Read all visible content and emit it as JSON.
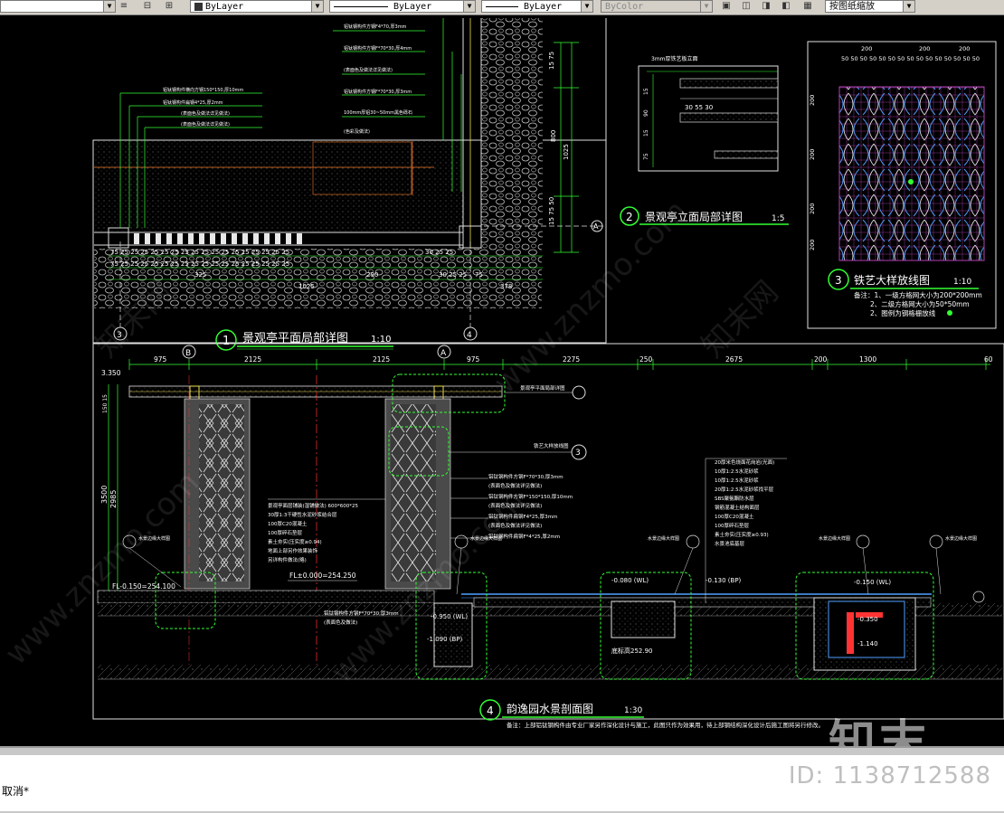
{
  "toolbar": {
    "layer_combo": "ByLayer",
    "linetype_combo": "ByLayer",
    "lineweight_combo": "ByLayer",
    "plotstyle_combo": "ByColor",
    "scale_combo": "按图纸缩放"
  },
  "drawing": {
    "title_1": "景观亭平面局部详图",
    "scale_1": "1:10",
    "title_2": "景观亭立面局部详图",
    "scale_2": "1:5",
    "title_3": "铁艺大样放线图",
    "scale_3": "1:10",
    "title_4": "韵逸园水景剖面图",
    "scale_4": "1:30",
    "num_1": "1",
    "num_2": "2",
    "num_3": "3",
    "num_4": "4",
    "grid_A": "A",
    "grid_B": "B",
    "note_3_head": "备注：1、一级方格网大小为200*200mm",
    "note_3_line2": "2、二级方格网大小为50*50mm",
    "note_3_line3": "2、图例为钢格栅放线",
    "note_4": "备注：上部铝钛钢构件由专业厂家另作深化设计与施工，此图只作为效果用，待上部钢结构深化设计后施工图将另行修改。",
    "dim_3350": "3.350",
    "dim_975a": "975",
    "dim_2125a": "2125",
    "dim_2125b": "2125",
    "dim_975b": "975",
    "dim_2275": "2275",
    "dim_250": "250",
    "dim_2675": "2675",
    "dim_200": "200",
    "dim_1300": "1300",
    "dim_60": "60",
    "dim_3500": "3500",
    "dim_2985": "2985",
    "level_fl": "FL-0.150=254.100",
    "level_fl0": "FL±0.000=254.250",
    "level_wl1": "-0.080 (WL)",
    "level_bp1": "-0.130 (BP)",
    "level_wl2": "-0.150 (WL)",
    "level_350": "-0.350",
    "level_1140": "-1.140",
    "level_1090": "-1.090 (BP)",
    "level_0950": "-0.950 (WL)",
    "level_bottom": "底标高252.90",
    "dim_325": "325",
    "dim_290": "290",
    "dim_1025": "1025",
    "dim_378": "378",
    "dim_800": "800",
    "dim_1025v": "1025",
    "dim_3mm": "3mm厚铁艺板立面",
    "dim_30_55_30": "30 55 30",
    "grid_top_200": "200",
    "grid_top_50": "50"
  },
  "status": {
    "command": "取消*"
  },
  "watermark": {
    "logo": "知末",
    "id": "ID: 1138712588"
  }
}
